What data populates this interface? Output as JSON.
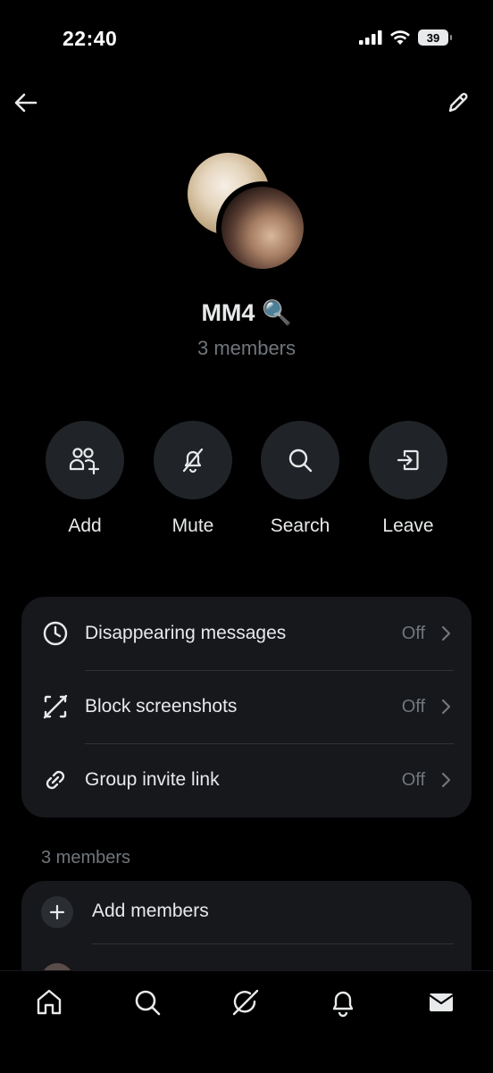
{
  "status_bar": {
    "time": "22:40",
    "battery": "39"
  },
  "group": {
    "name": "MM4 🔍",
    "members_count": "3 members"
  },
  "actions": [
    {
      "label": "Add",
      "icon": "add-people-icon"
    },
    {
      "label": "Mute",
      "icon": "bell-off-icon"
    },
    {
      "label": "Search",
      "icon": "search-icon"
    },
    {
      "label": "Leave",
      "icon": "leave-icon"
    }
  ],
  "settings": [
    {
      "label": "Disappearing messages",
      "value": "Off",
      "icon": "clock-icon"
    },
    {
      "label": "Block screenshots",
      "value": "Off",
      "icon": "screenshot-off-icon"
    },
    {
      "label": "Group invite link",
      "value": "Off",
      "icon": "link-icon"
    }
  ],
  "members_section": {
    "header": "3 members",
    "add_label": "Add members"
  },
  "tabbar": [
    "home-icon",
    "search-icon",
    "grok-icon",
    "bell-icon",
    "mail-icon"
  ]
}
